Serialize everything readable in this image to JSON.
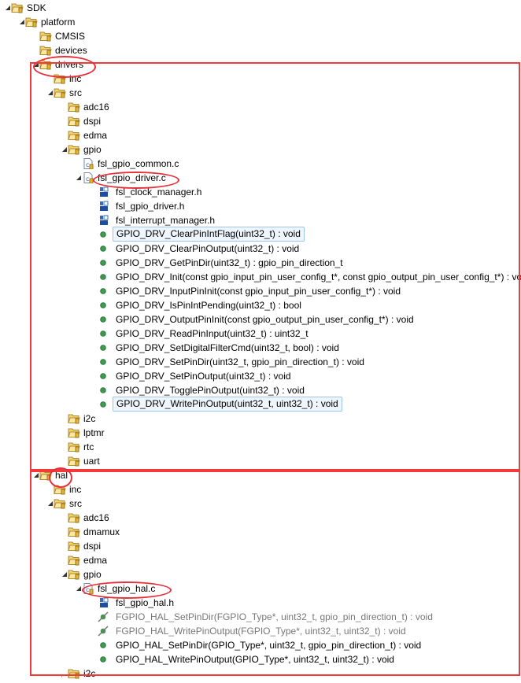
{
  "tree": [
    {
      "label": "SDK",
      "kind": "folder",
      "depth": 0,
      "expander": "open"
    },
    {
      "label": "platform",
      "kind": "folder",
      "depth": 1,
      "expander": "open"
    },
    {
      "label": "CMSIS",
      "kind": "folder",
      "depth": 2,
      "expander": "closed"
    },
    {
      "label": "devices",
      "kind": "folder",
      "depth": 2,
      "expander": "closed"
    },
    {
      "label": "drivers",
      "kind": "folder",
      "depth": 2,
      "expander": "open"
    },
    {
      "label": "inc",
      "kind": "folder",
      "depth": 3,
      "expander": "closed"
    },
    {
      "label": "src",
      "kind": "folder",
      "depth": 3,
      "expander": "open"
    },
    {
      "label": "adc16",
      "kind": "folder",
      "depth": 4,
      "expander": "closed"
    },
    {
      "label": "dspi",
      "kind": "folder",
      "depth": 4,
      "expander": "closed"
    },
    {
      "label": "edma",
      "kind": "folder",
      "depth": 4,
      "expander": "closed"
    },
    {
      "label": "gpio",
      "kind": "folder",
      "depth": 4,
      "expander": "open"
    },
    {
      "label": "fsl_gpio_common.c",
      "kind": "cfile",
      "depth": 5,
      "expander": "closed"
    },
    {
      "label": "fsl_gpio_driver.c",
      "kind": "cfile",
      "depth": 5,
      "expander": "open"
    },
    {
      "label": "fsl_clock_manager.h",
      "kind": "include",
      "depth": 6,
      "expander": "none"
    },
    {
      "label": "fsl_gpio_driver.h",
      "kind": "include",
      "depth": 6,
      "expander": "none"
    },
    {
      "label": "fsl_interrupt_manager.h",
      "kind": "include",
      "depth": 6,
      "expander": "none"
    },
    {
      "label": "GPIO_DRV_ClearPinIntFlag(uint32_t) : void",
      "kind": "function",
      "depth": 6,
      "expander": "none",
      "selected": true
    },
    {
      "label": "GPIO_DRV_ClearPinOutput(uint32_t) : void",
      "kind": "function",
      "depth": 6,
      "expander": "none"
    },
    {
      "label": "GPIO_DRV_GetPinDir(uint32_t) : gpio_pin_direction_t",
      "kind": "function",
      "depth": 6,
      "expander": "none"
    },
    {
      "label": "GPIO_DRV_Init(const gpio_input_pin_user_config_t*, const gpio_output_pin_user_config_t*) : void",
      "kind": "function",
      "depth": 6,
      "expander": "none"
    },
    {
      "label": "GPIO_DRV_InputPinInit(const gpio_input_pin_user_config_t*) : void",
      "kind": "function",
      "depth": 6,
      "expander": "none"
    },
    {
      "label": "GPIO_DRV_IsPinIntPending(uint32_t) : bool",
      "kind": "function",
      "depth": 6,
      "expander": "none"
    },
    {
      "label": "GPIO_DRV_OutputPinInit(const gpio_output_pin_user_config_t*) : void",
      "kind": "function",
      "depth": 6,
      "expander": "none"
    },
    {
      "label": "GPIO_DRV_ReadPinInput(uint32_t) : uint32_t",
      "kind": "function",
      "depth": 6,
      "expander": "none"
    },
    {
      "label": "GPIO_DRV_SetDigitalFilterCmd(uint32_t, bool) : void",
      "kind": "function",
      "depth": 6,
      "expander": "none"
    },
    {
      "label": "GPIO_DRV_SetPinDir(uint32_t, gpio_pin_direction_t) : void",
      "kind": "function",
      "depth": 6,
      "expander": "none"
    },
    {
      "label": "GPIO_DRV_SetPinOutput(uint32_t) : void",
      "kind": "function",
      "depth": 6,
      "expander": "none"
    },
    {
      "label": "GPIO_DRV_TogglePinOutput(uint32_t) : void",
      "kind": "function",
      "depth": 6,
      "expander": "none"
    },
    {
      "label": "GPIO_DRV_WritePinOutput(uint32_t, uint32_t) : void",
      "kind": "function",
      "depth": 6,
      "expander": "none",
      "selected": true
    },
    {
      "label": "i2c",
      "kind": "folder",
      "depth": 4,
      "expander": "closed"
    },
    {
      "label": "lptmr",
      "kind": "folder",
      "depth": 4,
      "expander": "closed"
    },
    {
      "label": "rtc",
      "kind": "folder",
      "depth": 4,
      "expander": "closed"
    },
    {
      "label": "uart",
      "kind": "folder",
      "depth": 4,
      "expander": "closed"
    },
    {
      "label": "hal",
      "kind": "folder",
      "depth": 2,
      "expander": "open"
    },
    {
      "label": "inc",
      "kind": "folder",
      "depth": 3,
      "expander": "closed"
    },
    {
      "label": "src",
      "kind": "folder",
      "depth": 3,
      "expander": "open"
    },
    {
      "label": "adc16",
      "kind": "folder",
      "depth": 4,
      "expander": "closed"
    },
    {
      "label": "dmamux",
      "kind": "folder",
      "depth": 4,
      "expander": "closed"
    },
    {
      "label": "dspi",
      "kind": "folder",
      "depth": 4,
      "expander": "closed"
    },
    {
      "label": "edma",
      "kind": "folder",
      "depth": 4,
      "expander": "closed"
    },
    {
      "label": "gpio",
      "kind": "folder",
      "depth": 4,
      "expander": "open"
    },
    {
      "label": "fsl_gpio_hal.c",
      "kind": "cfile",
      "depth": 5,
      "expander": "open"
    },
    {
      "label": "fsl_gpio_hal.h",
      "kind": "include",
      "depth": 6,
      "expander": "none"
    },
    {
      "label": "FGPIO_HAL_SetPinDir(FGPIO_Type*, uint32_t, gpio_pin_direction_t) : void",
      "kind": "inline-function",
      "depth": 6,
      "expander": "none"
    },
    {
      "label": "FGPIO_HAL_WritePinOutput(FGPIO_Type*, uint32_t, uint32_t) : void",
      "kind": "inline-function",
      "depth": 6,
      "expander": "none"
    },
    {
      "label": "GPIO_HAL_SetPinDir(GPIO_Type*, uint32_t, gpio_pin_direction_t) : void",
      "kind": "function",
      "depth": 6,
      "expander": "none"
    },
    {
      "label": "GPIO_HAL_WritePinOutput(GPIO_Type*, uint32_t, uint32_t) : void",
      "kind": "function",
      "depth": 6,
      "expander": "none"
    },
    {
      "label": "i2c",
      "kind": "folder",
      "depth": 4,
      "expander": "closed"
    }
  ],
  "colors": {
    "annotation": "#f23a3a",
    "selection_border": "#9ec4e8",
    "function_dot": "#3f9a4f",
    "folder": "#e8c25a"
  }
}
